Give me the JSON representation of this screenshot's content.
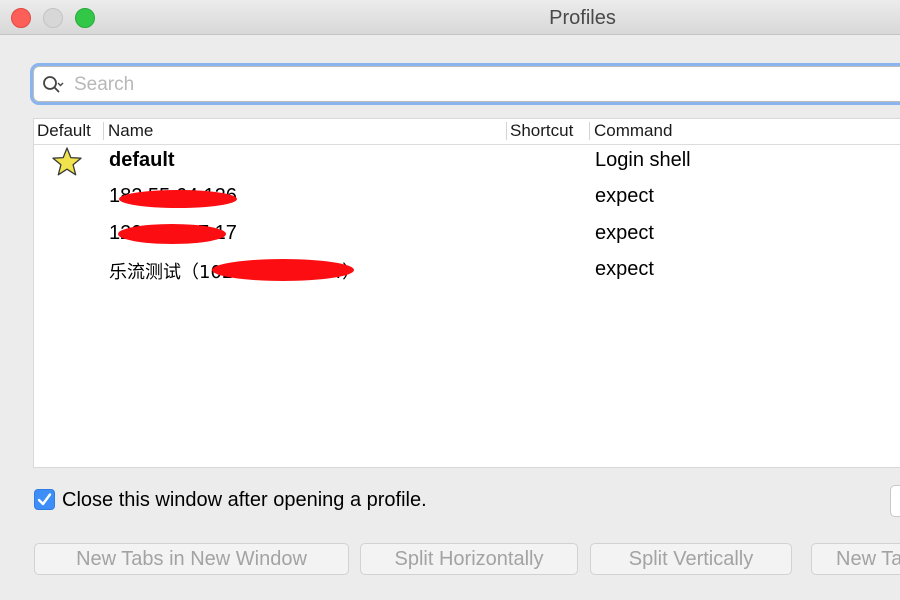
{
  "window": {
    "title": "Profiles"
  },
  "search": {
    "placeholder": "Search",
    "value": ""
  },
  "table": {
    "columns": [
      "Default",
      "Name",
      "Shortcut",
      "Command"
    ],
    "rows": [
      {
        "is_default": true,
        "name": "default",
        "shortcut": "",
        "command": "Login shell"
      },
      {
        "is_default": false,
        "name": "182.55.64.126",
        "shortcut": "",
        "command": "expect"
      },
      {
        "is_default": false,
        "name": "120.121.47.17",
        "shortcut": "",
        "command": "expect"
      },
      {
        "is_default": false,
        "name": "乐流测试（102.168.21.134）",
        "shortcut": "",
        "command": "expect"
      }
    ]
  },
  "options": {
    "close_after_open_label": "Close this window after opening a profile.",
    "close_after_open_checked": true
  },
  "buttons": {
    "new_tabs_new_window": "New Tabs in New Window",
    "split_horizontally": "Split Horizontally",
    "split_vertically": "Split Vertically",
    "new_tab": "New Ta"
  },
  "colors": {
    "accent": "#3d8ef8",
    "redaction": "#fb0d12",
    "star": "#f1e34d"
  }
}
